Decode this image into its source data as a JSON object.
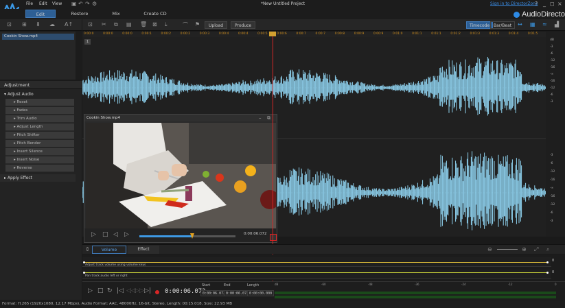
{
  "menubar": {
    "items": [
      "File",
      "Edit",
      "View"
    ],
    "project_title": "*New Untitled Project",
    "sign_in": "Sign in to DirectorZone",
    "help": "?",
    "minimize": "_",
    "maximize": "◻",
    "close": "×"
  },
  "modes": {
    "edit": "Edit",
    "restore": "Restore",
    "mix": "Mix",
    "create_cd": "Create CD",
    "app_name": "AudioDirector"
  },
  "toolbar": {
    "upload": "Upload",
    "produce": "Produce",
    "timecode": "Timecode",
    "bar_beat": "Bar/Beat"
  },
  "library": {
    "items": [
      "Cookin Show.mp4"
    ]
  },
  "adjustment": {
    "header": "Adjustment",
    "group": "Adjust Audio",
    "items": [
      "Reset",
      "Fades",
      "Trim Audio",
      "Adjust Length",
      "Pitch Shifter",
      "Pitch Bender",
      "Insert Silence",
      "Insert Noise",
      "Reverse"
    ],
    "apply_effect": "Apply Effect"
  },
  "ruler": {
    "ticks": [
      "0:00:0",
      "0:00:0",
      "0:00:0",
      "0:00:1",
      "0:00:2",
      "0:00:2",
      "0:00:3",
      "0:00:4",
      "0:00:4",
      "0:00:5",
      "0:00:6",
      "0:00:7",
      "0:00:7",
      "0:00:8",
      "0:00:9",
      "0:00:9",
      "0:01:0",
      "0:01:1",
      "0:01:1",
      "0:01:2",
      "0:01:3",
      "0:01:3",
      "0:01:4",
      "0:01:5"
    ]
  },
  "db_scale": {
    "top": [
      "dB",
      "-3",
      "-6",
      "-12",
      "-16",
      "-∞",
      "-16",
      "-12",
      "-6",
      "-3"
    ],
    "bottom": [
      "-3",
      "-6",
      "-12",
      "-16",
      "-∞",
      "-16",
      "-12",
      "-6",
      "-3"
    ]
  },
  "track": {
    "label": "1"
  },
  "video_preview": {
    "title": "Cookin Show.mp4",
    "time": "0:00:06.072",
    "progress": 0.55
  },
  "fx_tabs": {
    "volume": "Volume",
    "effect": "Effect"
  },
  "envelopes": {
    "volume_hint": "Adjust track volume using volume keys",
    "pan_hint": "Pan track audio left or right",
    "volume_value": "0",
    "pan_value": "0"
  },
  "transport": {
    "time": "0:00:06.072",
    "start_label": "Start",
    "end_label": "End",
    "length_label": "Length",
    "start_value": "0:00:06.072",
    "end_value": "0:00:06.072",
    "length_value": "0:00:00.000",
    "meter_scale": [
      "dB",
      "-60",
      "-48",
      "-36",
      "-24",
      "-12",
      "0"
    ]
  },
  "status": {
    "text": "Format: H.265 (1920x1080, 12.17 Mbps), Audio Format: AAC, 48000Hz, 16-bit, Stereo, Length: 00:15.018, Size: 22.93 MB"
  },
  "colors": {
    "accent": "#2d5f95",
    "waveform": "#8fd3f0",
    "playhead": "#d82626",
    "ruler": "#d18f1e",
    "envelope": "#e4c23a"
  }
}
